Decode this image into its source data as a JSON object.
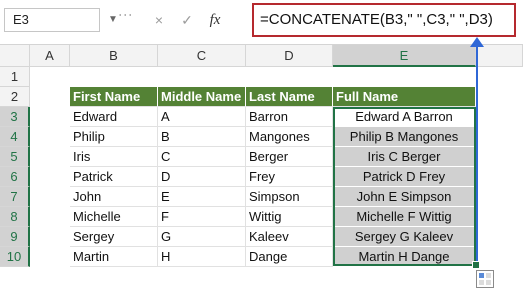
{
  "name_box": {
    "value": "E3"
  },
  "formula_bar": {
    "value": "=CONCATENATE(B3,\" \",C3,\" \",D3)",
    "cancel_icon": "×",
    "enter_icon": "✓",
    "insert_fn_label": "fx"
  },
  "columns": [
    "A",
    "B",
    "C",
    "D",
    "E"
  ],
  "rows": [
    "1",
    "2",
    "3",
    "4",
    "5",
    "6",
    "7",
    "8",
    "9",
    "10"
  ],
  "table_headers": [
    "First Name",
    "Middle Name",
    "Last Name",
    "Full Name"
  ],
  "table_rows": [
    [
      "Edward",
      "A",
      "Barron",
      "Edward A Barron"
    ],
    [
      "Philip",
      "B",
      "Mangones",
      "Philip B Mangones"
    ],
    [
      "Iris",
      "C",
      "Berger",
      "Iris C Berger"
    ],
    [
      "Patrick",
      "D",
      "Frey",
      "Patrick D Frey"
    ],
    [
      "John",
      "E",
      "Simpson",
      "John E Simpson"
    ],
    [
      "Michelle",
      "F",
      "Wittig",
      "Michelle F Wittig"
    ],
    [
      "Sergey",
      "G",
      "Kaleev",
      "Sergey G Kaleev"
    ],
    [
      "Martin",
      "H",
      "Dange",
      "Martin H Dange"
    ]
  ],
  "colors": {
    "header_fill": "#548235",
    "full_name_fill": "#d0d0d0",
    "selection_border": "#217346",
    "formula_highlight": "#b5292e",
    "arrow": "#2f67d6"
  },
  "icons": {
    "quick_analysis": "quick-analysis-icon"
  }
}
